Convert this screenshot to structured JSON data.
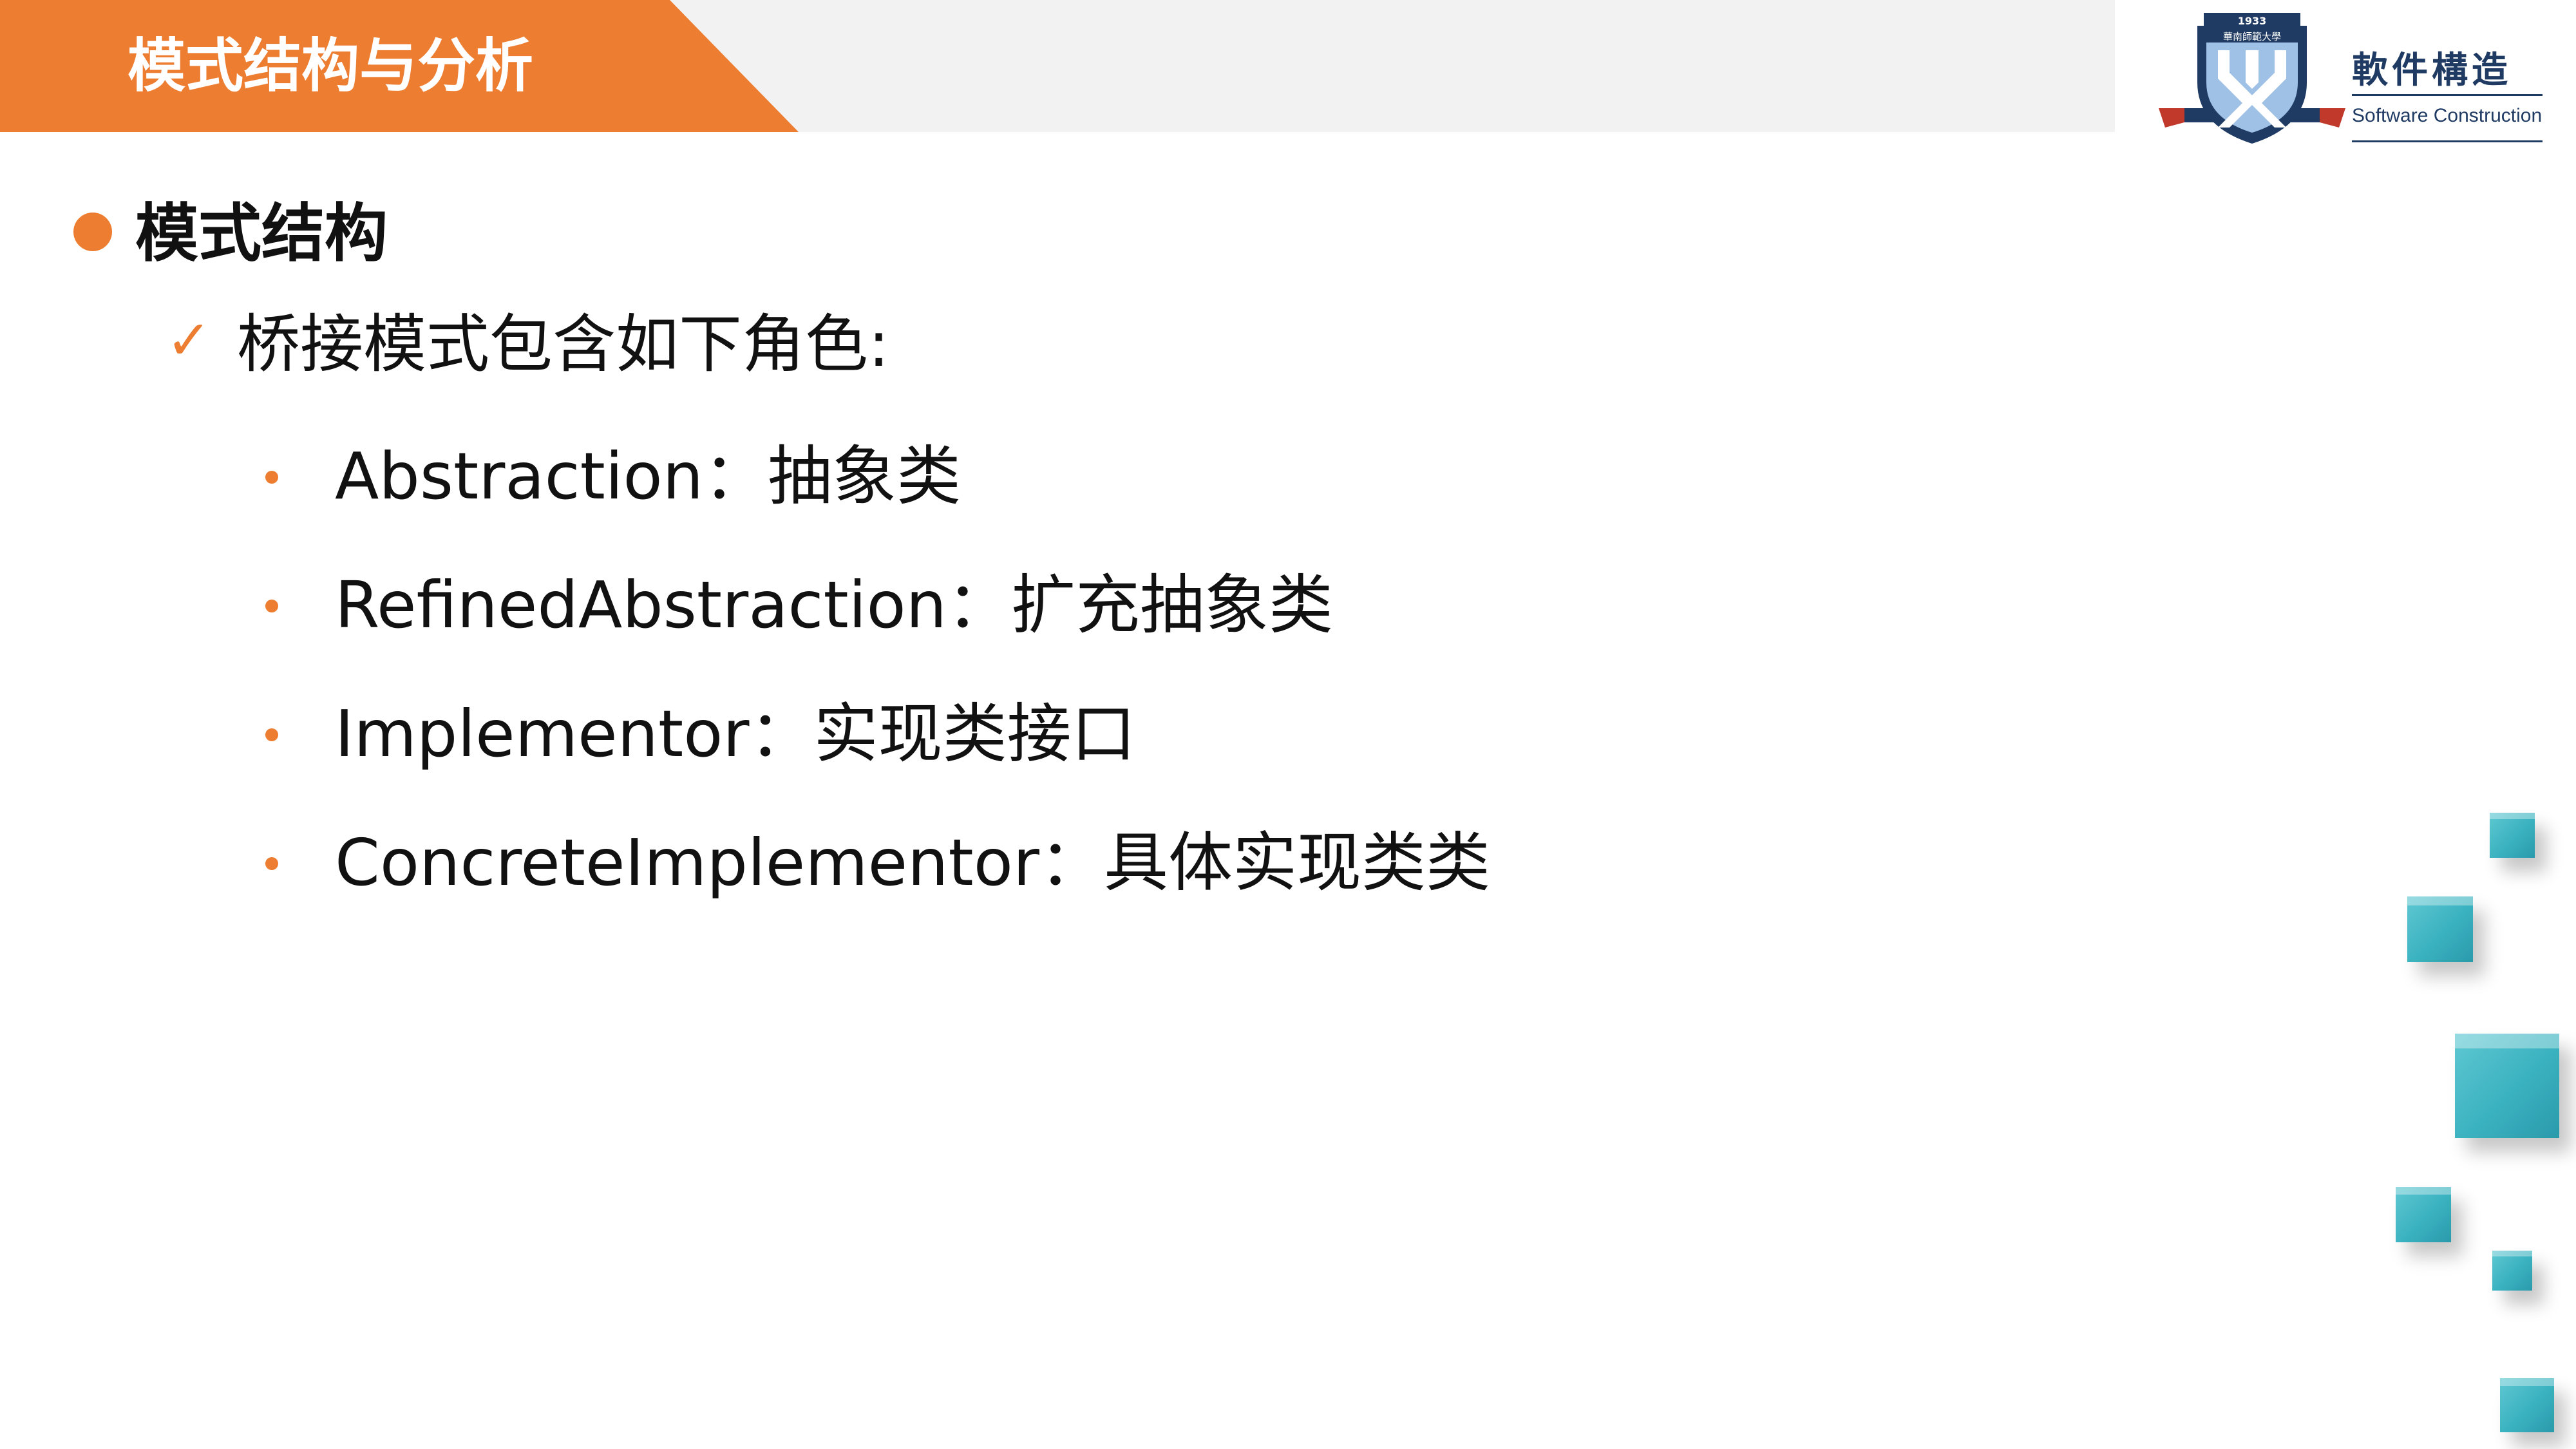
{
  "header": {
    "title": "模式结构与分析"
  },
  "logo": {
    "year": "1933",
    "university_cn": "華南師範大學",
    "course_cn": "軟件構造",
    "course_en": "Software Construction"
  },
  "content": {
    "section_heading": "模式结构",
    "intro": "桥接模式包含如下角色:",
    "roles": [
      "Abstraction：抽象类",
      "RefinedAbstraction：扩充抽象类",
      "Implementor：实现类接口",
      "ConcreteImplementor：具体实现类类"
    ]
  },
  "colors": {
    "accent": "#ed7d31",
    "header_band": "#f2f2f2",
    "logo_navy": "#1f3b63",
    "cube_teal": "#3bb2c0"
  }
}
